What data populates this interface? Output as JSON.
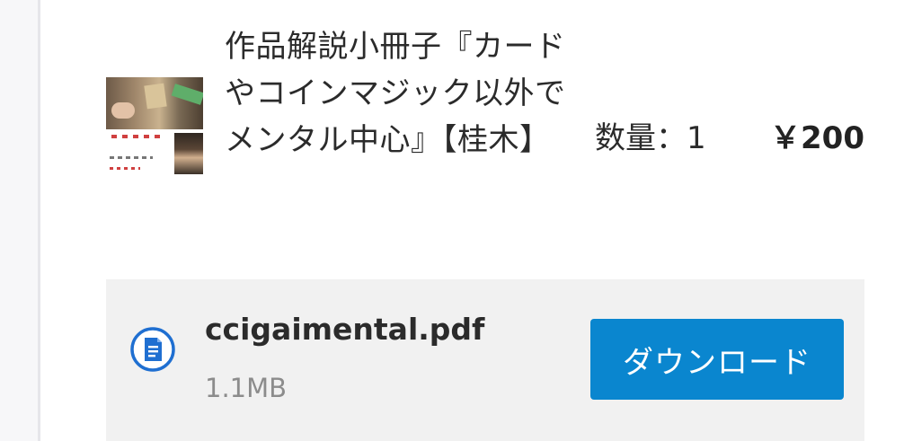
{
  "product": {
    "title": "作品解説小冊子『カードやコインマジック以外でメンタル中心』【桂木】",
    "thumbnail_icon": "product-thumbnail-image",
    "quantity_text": "数量：1",
    "price": "￥200"
  },
  "download": {
    "file_icon": "document-icon",
    "file_name": "ccigaimental.pdf",
    "file_size": "1.1MB",
    "button_label": "ダウンロード"
  },
  "colors": {
    "button_bg": "#0a86cf",
    "icon_blue": "#1f6fd1",
    "panel_bg": "#f1f1f1",
    "muted_text": "#8c8c8c"
  }
}
